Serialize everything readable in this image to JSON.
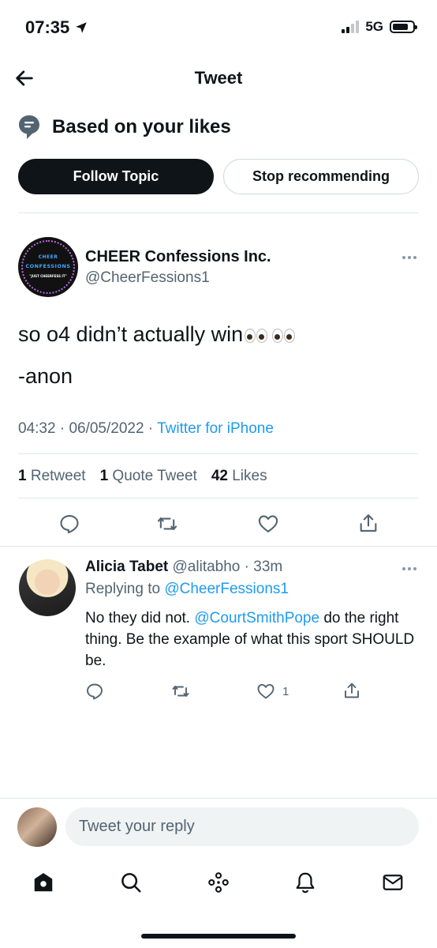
{
  "status_bar": {
    "time": "07:35",
    "network": "5G"
  },
  "header": {
    "title": "Tweet"
  },
  "topic": {
    "label": "Based on your likes",
    "follow_label": "Follow Topic",
    "stop_label": "Stop recommending"
  },
  "tweet": {
    "avatar_text": {
      "line1": "CHEER",
      "line2": "CONFESSIONS",
      "line3": "\"JUST CHEERFESS IT\""
    },
    "author_name": "CHEER Confessions Inc.",
    "author_handle": "@CheerFessions1",
    "text_line1": "so o4 didn’t actually win",
    "text_line2": "-anon",
    "time": "04:32",
    "date": "06/05/2022",
    "source": "Twitter for iPhone",
    "retweets": "1",
    "retweets_label": "Retweet",
    "quotes": "1",
    "quotes_label": "Quote Tweet",
    "likes": "42",
    "likes_label": "Likes"
  },
  "reply": {
    "author_name": "Alicia Tabet",
    "author_handle": "@alitabho",
    "time_ago": "33m",
    "replying_prefix": "Replying to",
    "replying_to": "@CheerFessions1",
    "text_part1": "No they did not.",
    "mention": "@CourtSmithPope",
    "text_part2": "do the right thing. Be the example of what this sport SHOULD be.",
    "like_count": "1"
  },
  "compose": {
    "placeholder": "Tweet your reply"
  },
  "colors": {
    "accent": "#1d9bf0",
    "text": "#0f1419",
    "muted": "#536471"
  }
}
